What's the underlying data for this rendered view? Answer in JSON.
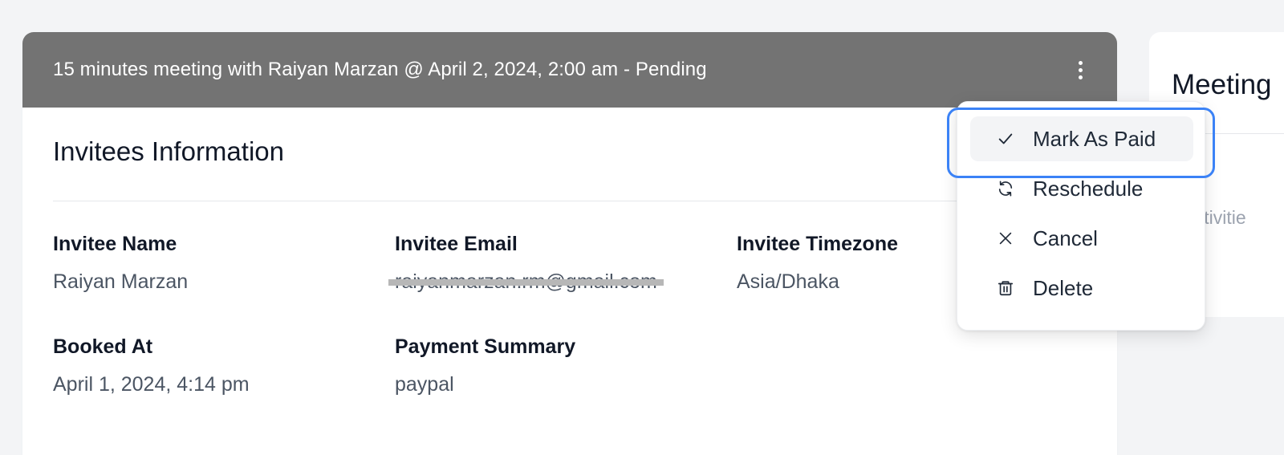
{
  "meeting": {
    "header_title": "15 minutes meeting with Raiyan Marzan @ April 2, 2024, 2:00 am - Pending"
  },
  "invitees": {
    "section_title": "Invitees Information",
    "fields": {
      "name": {
        "label": "Invitee Name",
        "value": "Raiyan Marzan"
      },
      "email": {
        "label": "Invitee Email",
        "value": "raiyanmarzan.rm@gmail.com"
      },
      "timezone": {
        "label": "Invitee Timezone",
        "value": "Asia/Dhaka"
      },
      "booked_at": {
        "label": "Booked At",
        "value": "April 1, 2024, 4:14 pm"
      },
      "payment": {
        "label": "Payment Summary",
        "value": "paypal"
      }
    }
  },
  "side_panel": {
    "title": "Meeting",
    "text": "activitie"
  },
  "menu": {
    "items": [
      {
        "label": "Mark As Paid",
        "icon": "check-icon"
      },
      {
        "label": "Reschedule",
        "icon": "refresh-icon"
      },
      {
        "label": "Cancel",
        "icon": "close-icon"
      },
      {
        "label": "Delete",
        "icon": "trash-icon"
      }
    ]
  },
  "colors": {
    "header_bg": "#737373",
    "focus_ring": "#3b82f6",
    "page_bg": "#f3f4f6"
  }
}
